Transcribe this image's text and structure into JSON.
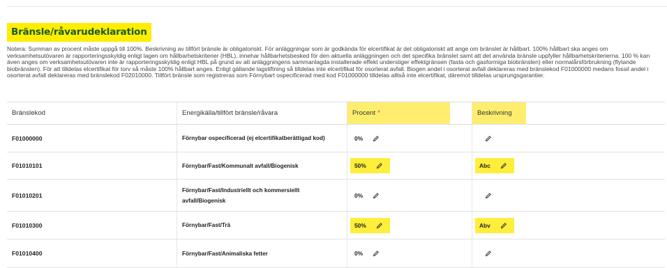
{
  "page": {
    "title": "Bränsle/råvarudeklaration",
    "note": "Notera: Summan av procent måste uppgå till 100%. Beskrivning av tillfört bränsle är obligatoriskt. För anläggningar som är godkända för elcertifikat är det obligatoriskt att ange om bränslet är hållbart. 100% hållbart ska anges om verksamhetsutövaren är rapporteringsskyldig enligt lagen om hållbarhetskriterier (HBL), innehar hållbarhetsbesked för den aktuella anläggningen och det specifika bränslet samt att det använda bränsle uppfyller hållbarhetskriterierna. 100 % kan även anges om verksamhetsutövaren inte är rapporteringsskyldig enligt HBL på grund av att anläggningens sammanlagda installerade effekt understiger effektgränsen (fasta och gasformiga biobränslen) eller normalårsförbrukning (flytande biobränslen). För att tilldelas elcertifikat för torv så måste 100% hållbart anges. Enligt gällande lagstiftning så tilldelas inte elcertifikat för osorterat avfall. Biogen andel i osorterat avfall deklareras med bränslekod F01000000 medans fossil andel i osorterat avfall deklareras med bränslekod F02010000. Tillfört bränsle som registreras som Förnybart ospecificerad med kod F01000000 tilldelas alltså inte elcertifikat, däremot tilldelas ursprungsgarantier."
  },
  "table": {
    "headers": {
      "code": "Bränslekod",
      "source": "Energikälla/tillfört bränsle/råvara",
      "percent": "Procent",
      "required_mark": "*",
      "description": "Beskrivning"
    },
    "rows": [
      {
        "code": "F01000000",
        "name": "Förnybar ospecificerad (ej elcertifikatberättigad kod)",
        "percent": "0%",
        "description": ""
      },
      {
        "code": "F01010101",
        "name": "Förnybar/Fast/Kommunalt avfall/Biogenisk",
        "percent": "50%",
        "description": "Abc"
      },
      {
        "code": "F01010201",
        "name": "Förnybar/Fast/Industriellt och kommersiellt avfall/Biogenisk",
        "percent": "0%",
        "description": ""
      },
      {
        "code": "F01010300",
        "name": "Förnybar/Fast/Trä",
        "percent": "50%",
        "description": "Abv"
      },
      {
        "code": "F01010400",
        "name": "Förnybar/Fast/Animaliska fetter",
        "percent": "0%",
        "description": ""
      }
    ]
  },
  "colors": {
    "highlight": "#ffee00",
    "title_text": "#1a5a22",
    "required": "#e03030"
  },
  "icons": {
    "edit": "pencil-icon"
  }
}
